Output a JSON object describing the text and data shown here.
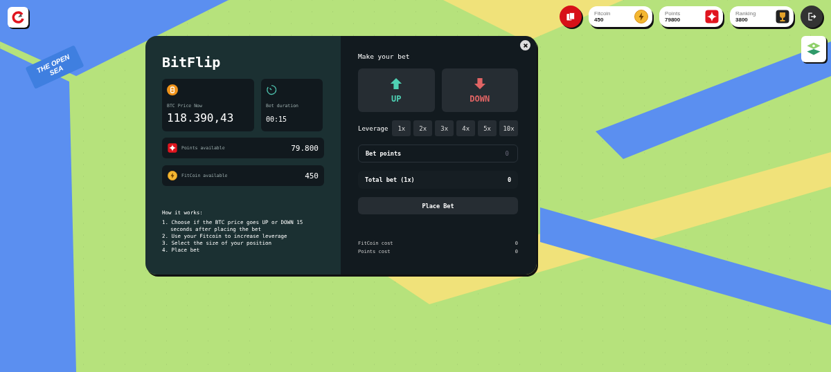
{
  "map": {
    "sign": "THE OPEN SEA"
  },
  "hud": {
    "stats": [
      {
        "kind": "fitcoin",
        "label": "Fitcoin",
        "value": "450"
      },
      {
        "kind": "points",
        "label": "Points",
        "value": "79800"
      },
      {
        "kind": "ranking",
        "label": "Ranking",
        "value": "3800"
      }
    ]
  },
  "modal": {
    "title": "BitFlip",
    "price": {
      "label": "BTC Price Now",
      "value": "118.390,43"
    },
    "duration": {
      "label": "Bet duration",
      "value": "00:15"
    },
    "balances": [
      {
        "kind": "points",
        "label": "Points available",
        "value": "79.800"
      },
      {
        "kind": "fitcoin",
        "label": "FitCoin available",
        "value": "450"
      }
    ],
    "how_title": "How it works:",
    "steps": [
      "1. Choose if the BTC price goes UP or DOWN 15 seconds after placing the bet",
      "2. Use your Fitcoin to increase leverage",
      "3. Select the size of your position",
      "4. Place bet"
    ],
    "bet_title": "Make your bet",
    "directions": [
      {
        "kind": "up",
        "label": "UP"
      },
      {
        "kind": "down",
        "label": "DOWN"
      }
    ],
    "leverage_label": "Leverage",
    "leverage": [
      "1x",
      "2x",
      "3x",
      "4x",
      "5x",
      "10x"
    ],
    "bet_points": {
      "label": "Bet points",
      "placeholder": "0"
    },
    "total": {
      "label": "Total bet (1x)",
      "value": "0"
    },
    "place_button": "Place Bet",
    "costs": [
      {
        "label": "FitCoin cost",
        "value": "0"
      },
      {
        "label": "Points cost",
        "value": "0"
      }
    ]
  }
}
